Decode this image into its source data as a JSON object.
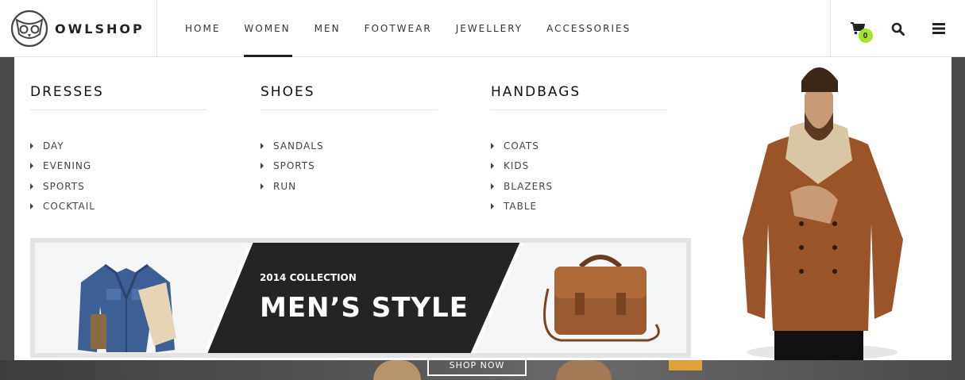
{
  "brand": {
    "name": "OWLSHOP",
    "logo_icon": "owl-logo-icon"
  },
  "nav": {
    "items": [
      {
        "label": "HOME",
        "active": false
      },
      {
        "label": "WOMEN",
        "active": true
      },
      {
        "label": "MEN",
        "active": false
      },
      {
        "label": "FOOTWEAR",
        "active": false
      },
      {
        "label": "JEWELLERY",
        "active": false
      },
      {
        "label": "ACCESSORIES",
        "active": false
      }
    ]
  },
  "tools": {
    "cart_icon": "cart-icon",
    "cart_count": "0",
    "search_icon": "search-icon",
    "menu_icon": "hamburger-menu-icon",
    "badge_color": "#a6e22e"
  },
  "mega_menu": {
    "columns": [
      {
        "title": "DRESSES",
        "items": [
          "DAY",
          "EVENING",
          "SPORTS",
          "COCKTAIL"
        ]
      },
      {
        "title": "SHOES",
        "items": [
          "SANDALS",
          "SPORTS",
          "RUN"
        ]
      },
      {
        "title": "HANDBAGS",
        "items": [
          "COATS",
          "KIDS",
          "BLAZERS",
          "TABLE"
        ]
      }
    ],
    "banner": {
      "subtitle": "2014 COLLECTION",
      "title": "MEN’S STYLE",
      "dark_color": "#242424"
    }
  },
  "hero": {
    "button_label": "SHOP NOW"
  }
}
